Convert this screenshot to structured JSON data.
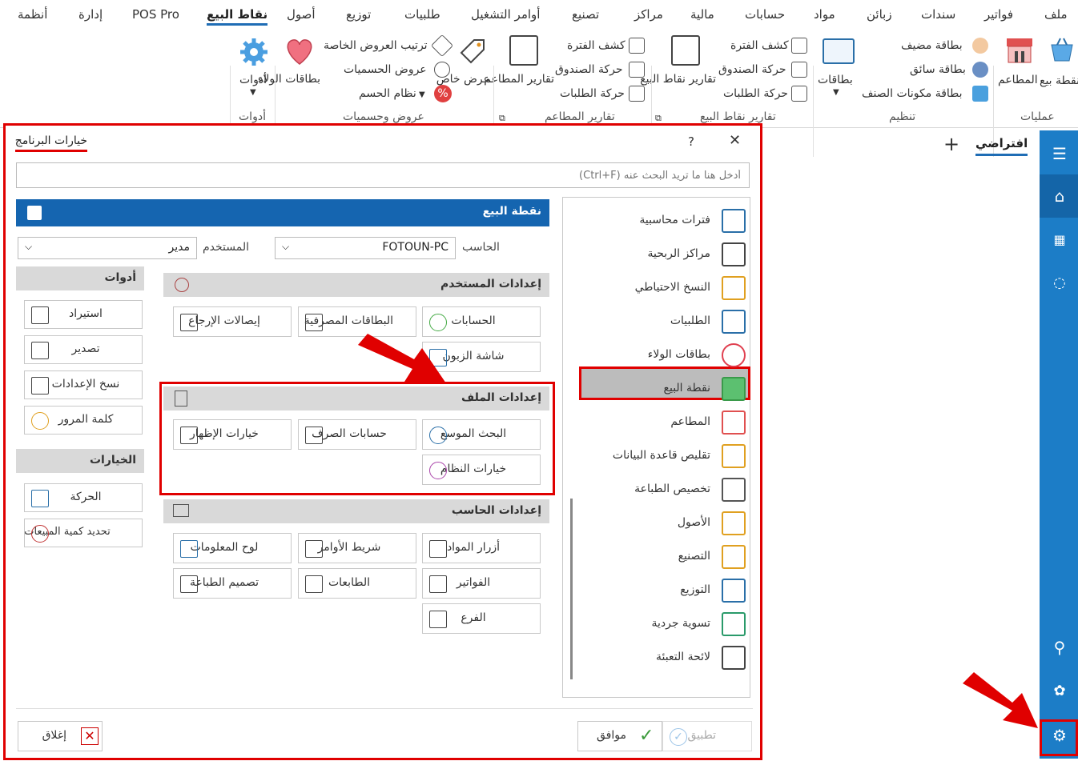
{
  "menu": {
    "items": [
      "ملف",
      "فواتير",
      "سندات",
      "زبائن",
      "مواد",
      "حسابات",
      "مالية",
      "مراكز",
      "تصنيع",
      "أوامر التشغيل",
      "طلبيات",
      "توزيع",
      "أصول",
      "نقاط البيع",
      "POS Pro",
      "إدارة",
      "أنظمة"
    ],
    "active": "نقاط البيع"
  },
  "ribbon": {
    "pos_point": "نقطة بيع",
    "restaurants": "المطاعم",
    "guest_card": "بطاقة مضيف",
    "driver_card": "بطاقة سائق",
    "item_components_card": "بطاقة مكونات الصنف",
    "cards": "بطاقات",
    "period_statement_1": "كشف الفترة",
    "cash_movement_1": "حركة الصندوق",
    "orders_movement_1": "حركة الطلبات",
    "pos_reports": "تقارير نقاط البيع",
    "period_statement_2": "كشف الفترة",
    "cash_movement_2": "حركة الصندوق",
    "orders_movement_2": "حركة الطلبات",
    "restaurant_reports": "تقارير المطاعم",
    "special_offer": "عرض خاص",
    "offers_order": "ترتيب العروض الخاصة",
    "discount_offers": "عروض الحسميات",
    "discount_system": "نظام الحسم",
    "loyalty_cards": "بطاقات الولاء",
    "tools": "أدوات",
    "group_operations": "عمليات",
    "group_organize": "تنظيم",
    "group_pos_reports": "تقارير نقاط البيع",
    "group_restaurant_reports": "تقارير المطاعم",
    "group_offers": "عروض وحسميات",
    "group_tools": "أدوات"
  },
  "workspace": {
    "tab_default": "افتراضي",
    "add_tab": "+"
  },
  "dialog": {
    "title": "خيارات البرنامج",
    "help": "?",
    "close": "✕",
    "search_placeholder": "أدخل هنا ما تريد البحث عنه (Ctrl+F)",
    "categories": [
      "فترات محاسبية",
      "مراكز الربحية",
      "النسخ الاحتياطي",
      "الطلبيات",
      "بطاقات الولاء",
      "نقطة البيع",
      "المطاعم",
      "تقليص قاعدة البيانات",
      "تخصيص الطباعة",
      "الأصول",
      "التصنيع",
      "التوزيع",
      "تسوية جردية",
      "لائحة التعبئة"
    ],
    "selected_category": "نقطة البيع",
    "header": "نقطة البيع",
    "computer_label": "الحاسب",
    "computer_value": "FOTOUN-PC",
    "user_label": "المستخدم",
    "user_value": "مدير",
    "user_settings": "إعدادات المستخدم",
    "user_buttons": [
      "الحسابات",
      "البطاقات المصرفية",
      "إيصالات الإرجاع",
      "شاشة الزبون"
    ],
    "file_settings": "إعدادات الملف",
    "file_buttons": [
      "البحث الموسع",
      "حسابات الصرف",
      "خيارات الإظهار",
      "خيارات النظام"
    ],
    "computer_settings": "إعدادات الحاسب",
    "computer_buttons": [
      "أزرار المواد",
      "شريط الأوامر",
      "لوح المعلومات",
      "الفواتير",
      "الطابعات",
      "تصميم الطباعة",
      "الفرع"
    ],
    "tools_header": "أدوات",
    "tools_buttons": [
      "استيراد",
      "تصدير",
      "نسخ الإعدادات",
      "كلمة المرور"
    ],
    "options_header": "الخيارات",
    "options_buttons": [
      "الحركة",
      "تحديد كمية المبيعات"
    ],
    "close_button": "إغلاق",
    "ok_button": "موافق",
    "apply_button": "تطبيق"
  },
  "colors": {
    "accent": "#1f6db5",
    "sidebar": "#1c7dc7",
    "highlight": "#e00000",
    "header_bar": "#1565b0"
  }
}
